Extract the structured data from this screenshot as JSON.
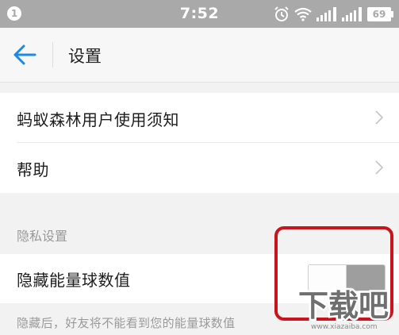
{
  "status_bar": {
    "notification_count": "1",
    "time": "7:52",
    "battery": "69",
    "icons": [
      "alarm-icon",
      "wifi-icon",
      "signal-icon",
      "signal-icon"
    ]
  },
  "header": {
    "title": "设置",
    "back_icon": "arrow-left-icon"
  },
  "menu": {
    "items": [
      {
        "label": "蚂蚁森林用户使用须知",
        "icon": "chevron-right-icon"
      },
      {
        "label": "帮助",
        "icon": "chevron-right-icon"
      }
    ]
  },
  "privacy": {
    "section_title": "隐私设置",
    "toggle_label": "隐藏能量球数值",
    "toggle_state": "off",
    "hint": "隐藏后，好友将不能看到您的能量球数值"
  },
  "colors": {
    "accent": "#1e88e5",
    "highlight": "#c8141c",
    "status_bar": "#a9a9a9"
  },
  "watermark": {
    "text": "下载吧",
    "url": "www.xiazaiba.com"
  }
}
